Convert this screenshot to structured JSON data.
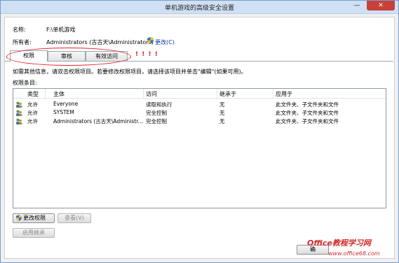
{
  "window": {
    "title": "单机游戏的高级安全设置",
    "minimize_glyph": "—",
    "close_glyph": "✕"
  },
  "info": {
    "name_label": "名称:",
    "name_value": "F:\\单机游戏",
    "owner_label": "所有者:",
    "owner_value": "Administrators (古古天\\Administrators)",
    "change_link": "更改(C)"
  },
  "tabs": [
    {
      "label": "权限"
    },
    {
      "label": "审核"
    },
    {
      "label": "有效访问"
    }
  ],
  "annotation": {
    "exclaim": "! ! ! !",
    "color": "#dd2222"
  },
  "instructions": "如需其他信息，请双击权限项目。若要修改权限项目，请选择该项目并单击\"编辑\"(如果可用)。",
  "entries_label": "权限条目:",
  "table": {
    "headers": [
      "类型",
      "主体",
      "访问",
      "继承于",
      "应用于"
    ],
    "rows": [
      {
        "type": "允许",
        "principal": "Everyone",
        "access": "读取和执行",
        "inherited": "无",
        "applies": "此文件夹、子文件夹和文件"
      },
      {
        "type": "允许",
        "principal": "SYSTEM",
        "access": "完全控制",
        "inherited": "无",
        "applies": "此文件夹、子文件夹和文件"
      },
      {
        "type": "允许",
        "principal": "Administrators (古古天\\Administr...",
        "access": "完全控制",
        "inherited": "无",
        "applies": "此文件夹、子文件夹和文件"
      }
    ]
  },
  "buttons": {
    "change_permissions": "更改权限",
    "view": "查看(V)",
    "enable_inheritance": "启用继承",
    "ok": "确"
  },
  "watermark": {
    "text": "Office教程学习网",
    "url": "www.office68.com"
  },
  "icons": {
    "shield": "shield-icon",
    "user": "user-icon"
  }
}
